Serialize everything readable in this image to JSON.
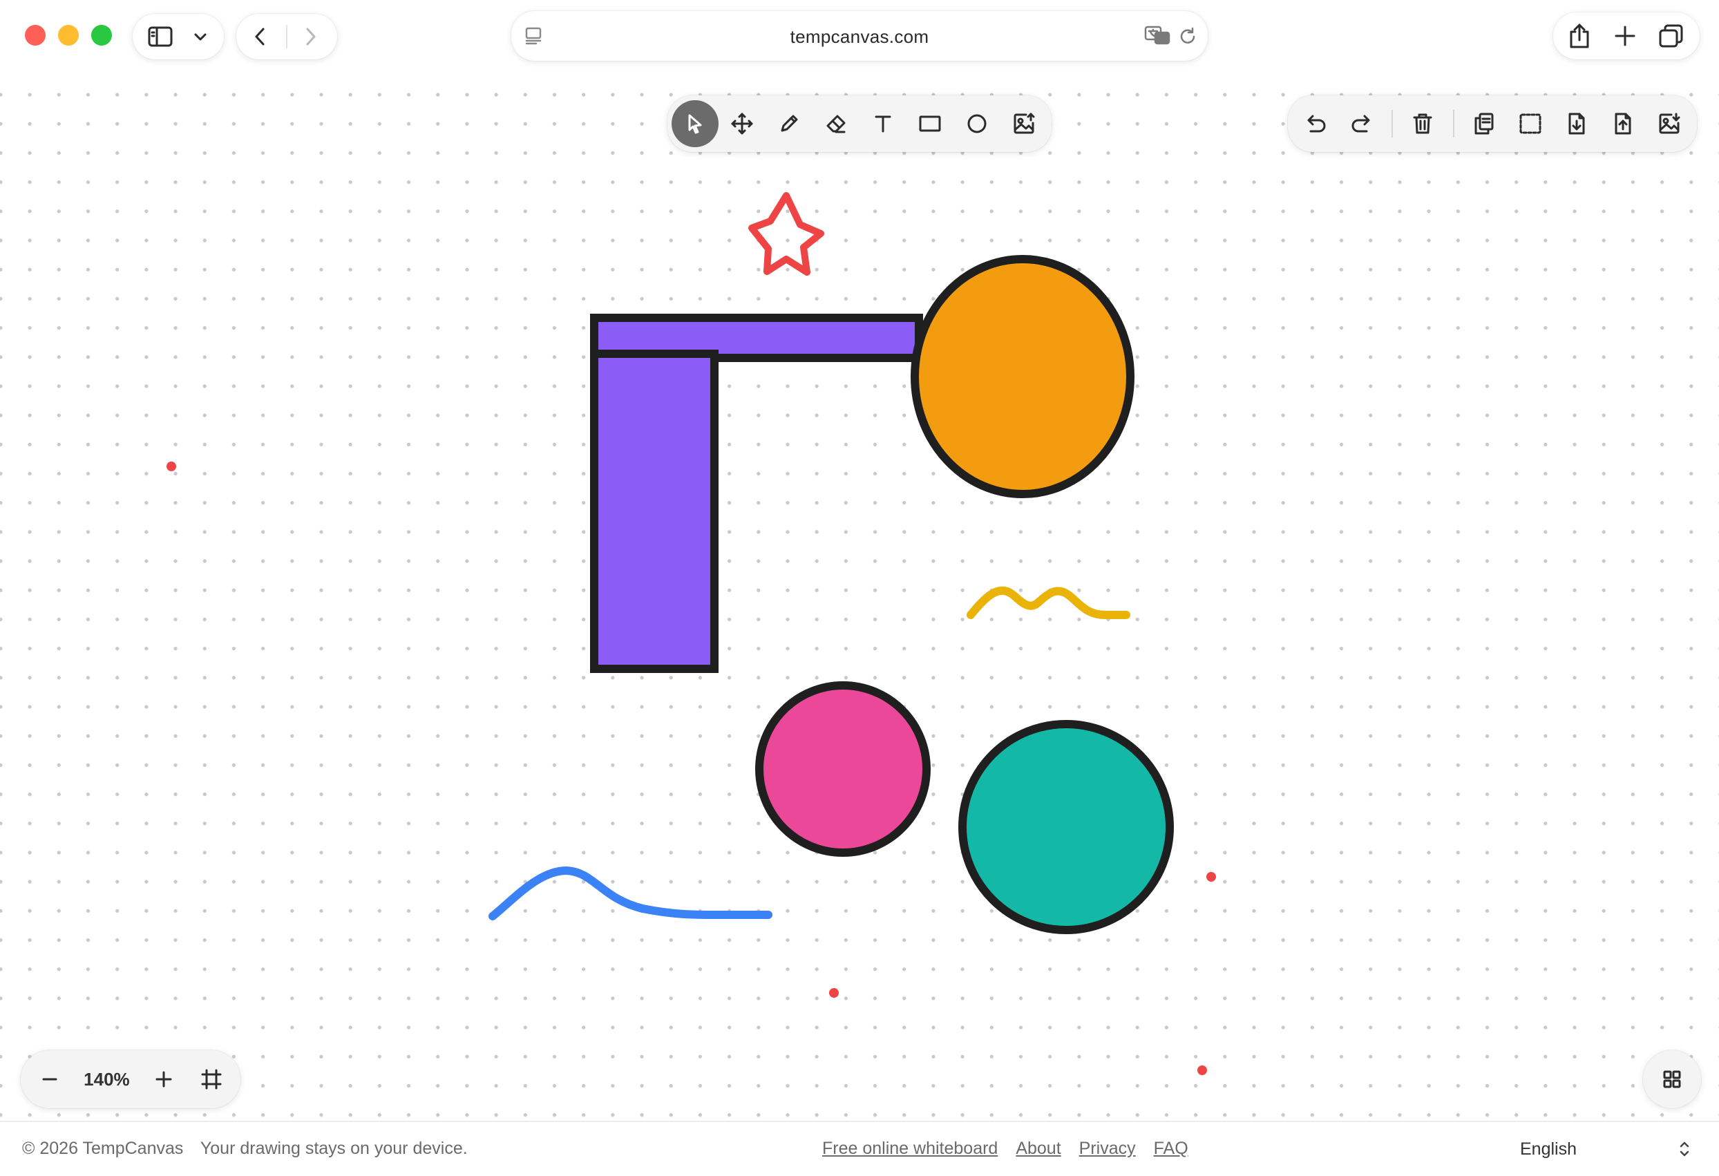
{
  "browser": {
    "url": "tempcanvas.com",
    "traffic_colors": [
      "#ff5f57",
      "#febc2e",
      "#28c840"
    ],
    "icons": [
      "sidebar-icon",
      "chevron-down-icon",
      "back-icon",
      "forward-icon",
      "reader-icon",
      "translate-icon",
      "reload-icon",
      "share-icon",
      "new-tab-icon",
      "tabs-overview-icon"
    ]
  },
  "toolbar": {
    "active_tool": "select",
    "tools": [
      "select",
      "pan",
      "pencil",
      "eraser",
      "text",
      "rectangle",
      "ellipse",
      "image"
    ]
  },
  "actions": [
    "undo",
    "redo",
    "delete",
    "duplicate",
    "screenshot",
    "save",
    "open",
    "export-image"
  ],
  "canvas": {
    "shapes": [
      {
        "kind": "rectangle",
        "fill": "#8b5cf6",
        "stroke": "#1f1f1f"
      },
      {
        "kind": "rectangle",
        "fill": "#8b5cf6",
        "stroke": "#1f1f1f"
      },
      {
        "kind": "ellipse",
        "fill": "#f39c0f",
        "stroke": "#1f1f1f"
      },
      {
        "kind": "ellipse",
        "fill": "#ec4899",
        "stroke": "#1f1f1f"
      },
      {
        "kind": "ellipse",
        "fill": "#14b8a6",
        "stroke": "#1f1f1f"
      },
      {
        "kind": "freehand-star",
        "stroke": "#ef4444"
      },
      {
        "kind": "freehand-squiggle",
        "stroke": "#eab308"
      },
      {
        "kind": "freehand-wave",
        "stroke": "#3b82f6"
      },
      {
        "kind": "dot",
        "fill": "#ef4444"
      }
    ]
  },
  "zoom": {
    "value": "140%",
    "minus": "−",
    "plus": "+"
  },
  "footer": {
    "copyright": "© 2026 TempCanvas",
    "tagline": "Your drawing stays on your device.",
    "links": [
      "Free online whiteboard",
      "About",
      "Privacy",
      "FAQ"
    ],
    "language": "English"
  },
  "colors": {
    "canvas_bg": "#ffffff",
    "grid_dot": "#c9c9c9",
    "toolbar_bg": "#f4f4f5",
    "active_tool_bg": "#6b6b6b"
  }
}
